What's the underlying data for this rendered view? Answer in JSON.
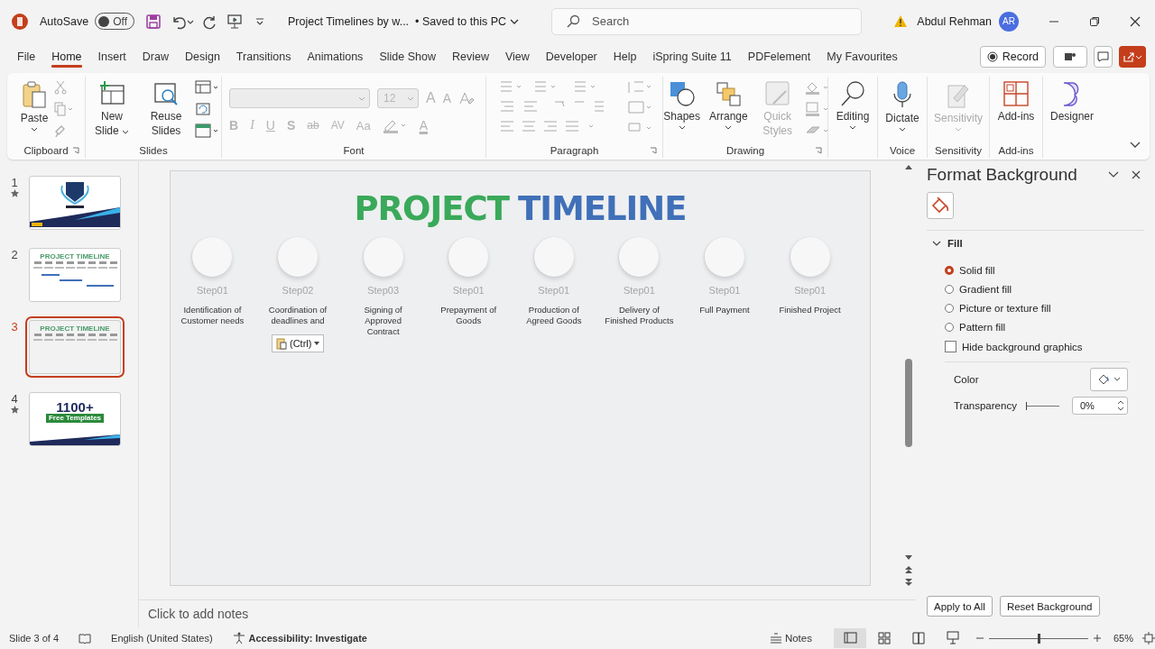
{
  "title_bar": {
    "autosave": {
      "label": "AutoSave",
      "on": false,
      "state_text": "Off"
    },
    "document_title": "Project Timelines by w...",
    "save_status": "• Saved to this PC",
    "search": {
      "placeholder": "Search"
    },
    "user": {
      "name": "Abdul Rehman",
      "initials": "AR"
    }
  },
  "tabs": [
    {
      "label": "File",
      "selected": false
    },
    {
      "label": "Home",
      "selected": true
    },
    {
      "label": "Insert",
      "selected": false
    },
    {
      "label": "Draw",
      "selected": false
    },
    {
      "label": "Design",
      "selected": false
    },
    {
      "label": "Transitions",
      "selected": false
    },
    {
      "label": "Animations",
      "selected": false
    },
    {
      "label": "Slide Show",
      "selected": false
    },
    {
      "label": "Review",
      "selected": false
    },
    {
      "label": "View",
      "selected": false
    },
    {
      "label": "Developer",
      "selected": false
    },
    {
      "label": "Help",
      "selected": false
    },
    {
      "label": "iSpring Suite 11",
      "selected": false
    },
    {
      "label": "PDFelement",
      "selected": false
    },
    {
      "label": "My Favourites",
      "selected": false
    }
  ],
  "record_button": "Record",
  "ribbon": {
    "clipboard": {
      "label": "Clipboard",
      "paste": "Paste"
    },
    "slides": {
      "label": "Slides",
      "new_slide": "New Slide",
      "reuse_slides": "Reuse Slides"
    },
    "font": {
      "label": "Font",
      "disabled": true,
      "size": "12",
      "grow": "A",
      "shrink": "A",
      "format_buttons": [
        "B",
        "I",
        "U",
        "S",
        "ab",
        "AV",
        "Aa"
      ],
      "color_letter": "A"
    },
    "paragraph": {
      "label": "Paragraph",
      "disabled": true
    },
    "drawing": {
      "label": "Drawing",
      "shapes": "Shapes",
      "arrange": "Arrange",
      "quick_styles": "Quick Styles",
      "quick_styles_disabled": true
    },
    "editing": {
      "label": "Editing"
    },
    "voice": {
      "label": "Voice",
      "dictate": "Dictate"
    },
    "sensitivity": {
      "label": "Sensitivity",
      "button": "Sensitivity",
      "disabled": true
    },
    "addins": {
      "label": "Add-ins",
      "button": "Add-ins"
    },
    "designer": {
      "button": "Designer"
    }
  },
  "slides_panel": [
    {
      "number": "1",
      "starred": true,
      "selected": false,
      "kind": "cover"
    },
    {
      "number": "2",
      "starred": false,
      "selected": false,
      "kind": "timeline",
      "heading": "PROJECT TIMELINE"
    },
    {
      "number": "3",
      "starred": false,
      "selected": true,
      "kind": "timeline",
      "heading": "PROJECT TIMELINE"
    },
    {
      "number": "4",
      "starred": true,
      "selected": false,
      "kind": "promo",
      "heading": "1100+",
      "subheading": "Free Templates"
    }
  ],
  "slide": {
    "title_parts": [
      {
        "text": "PROJECT",
        "color": "#3aa95a"
      },
      {
        "text": "TIMELINE",
        "color": "#4070b8"
      }
    ],
    "steps": [
      {
        "step": "Step01",
        "lines": [
          "Identification of",
          "Customer needs"
        ]
      },
      {
        "step": "Step02",
        "lines": [
          "Coordination of",
          "deadlines and"
        ]
      },
      {
        "step": "Step03",
        "lines": [
          "Signing of",
          "Approved",
          "Contract"
        ]
      },
      {
        "step": "Step01",
        "lines": [
          "Prepayment of",
          "Goods"
        ]
      },
      {
        "step": "Step01",
        "lines": [
          "Production of",
          "Agreed Goods"
        ]
      },
      {
        "step": "Step01",
        "lines": [
          "Delivery of",
          "Finished Products"
        ]
      },
      {
        "step": "Step01",
        "lines": [
          "Full Payment"
        ]
      },
      {
        "step": "Step01",
        "lines": [
          "Finished Project"
        ]
      }
    ],
    "paste_options": "(Ctrl)"
  },
  "notes_placeholder": "Click to add notes",
  "format_pane": {
    "title": "Format Background",
    "section": {
      "label": "Fill",
      "expanded": true
    },
    "fill_options": [
      {
        "label": "Solid fill",
        "selected": true
      },
      {
        "label": "Gradient fill",
        "selected": false
      },
      {
        "label": "Picture or texture fill",
        "selected": false
      },
      {
        "label": "Pattern fill",
        "selected": false
      }
    ],
    "hide_graphics": {
      "label": "Hide background graphics",
      "checked": false
    },
    "color_label": "Color",
    "transparency": {
      "label": "Transparency",
      "level": 0,
      "value": "0%"
    },
    "buttons": [
      "Apply to All",
      "Reset Background"
    ]
  },
  "status_bar": {
    "slide_counter": "Slide 3 of 4",
    "language": "English (United States)",
    "accessibility": "Accessibility: Investigate",
    "notes": "Notes",
    "zoom": {
      "level": 0.5,
      "value": "65%"
    }
  }
}
